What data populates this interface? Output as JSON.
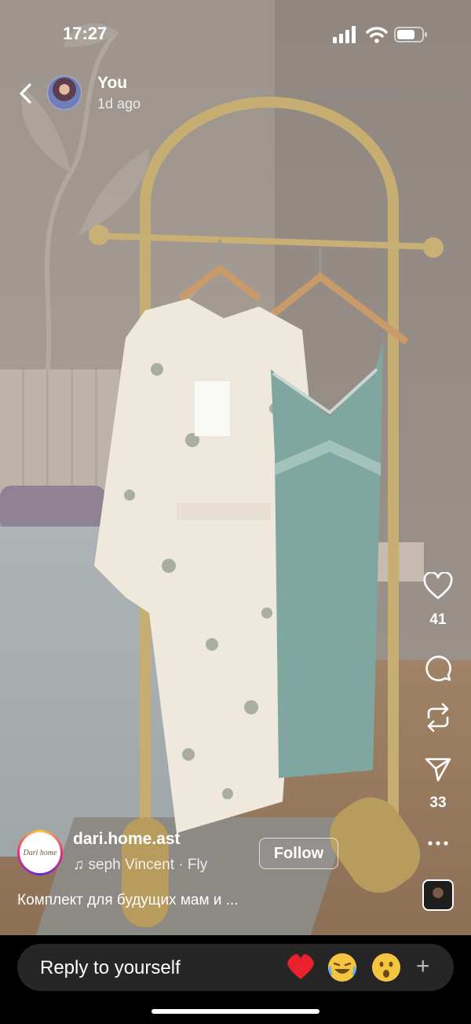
{
  "status_bar": {
    "time": "17:27"
  },
  "header": {
    "user_name": "You",
    "time_ago": "1d ago"
  },
  "actions": {
    "likes": "41",
    "shares": "33"
  },
  "author": {
    "name": "dari.home.ast",
    "avatar_text": "Dari home",
    "music": "seph Vincent · Fly",
    "follow_label": "Follow"
  },
  "caption": "Комплект для будущих мам и ...",
  "reply": {
    "placeholder": "Reply to yourself",
    "plus": "+"
  },
  "icons": [
    "back-icon",
    "signal-icon",
    "wifi-icon",
    "battery-icon",
    "heart-icon",
    "comment-icon",
    "repost-icon",
    "send-icon",
    "more-icon",
    "music-note-icon"
  ],
  "colors": {
    "accent": "#ff3040",
    "reply_bg": "#262626"
  }
}
